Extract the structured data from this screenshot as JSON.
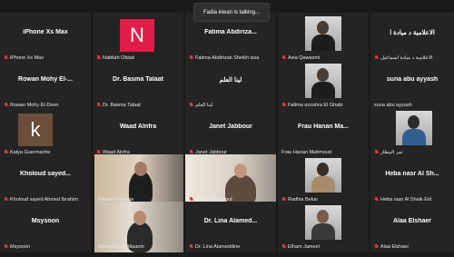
{
  "toast": {
    "text": "Fadia kiwan is talking..."
  },
  "tiles": [
    {
      "big": "iPhone Xs Max",
      "small": "iPhone Xs Max"
    },
    {
      "big": "",
      "small": "Nabilah Obiad",
      "avatar": "N",
      "avatar_color": "#e11d48"
    },
    {
      "big": "Fatima  Abdiriza...",
      "small": "Fatima Abdirizak Sheikh issa"
    },
    {
      "big": "",
      "small": "Asia Qawasmi",
      "photo": true
    },
    {
      "big": "الاعلامية د ميادة ا",
      "small": "الاعلامية د ميادة اسماعيل"
    },
    {
      "big": "Rowan  Mohy  El-...",
      "small": "Rowan Mohy El-Deen"
    },
    {
      "big": "Dr. Basma Talaat",
      "small": "Dr. Basma Talaat"
    },
    {
      "big": "لينا العلم",
      "small": "لينا العلم"
    },
    {
      "big": "",
      "small": "Fatima ezzahra El Ghabi",
      "photo": true
    },
    {
      "big": "suna abu ayyash",
      "small": "suna abu ayyash"
    },
    {
      "big": "",
      "small": "Katya Guermache",
      "avatar": "k",
      "avatar_color": "#6b4f3a"
    },
    {
      "big": "Waad Alnfra",
      "small": "Waad Alnfra"
    },
    {
      "big": "Janet Jabbour",
      "small": "Janet Jabbour"
    },
    {
      "big": "Frau  Hanan  Ma...",
      "small": "Frau Hanan Mahmoud"
    },
    {
      "big": "",
      "small": "تمر البيطار",
      "photo": true
    },
    {
      "big": "Kholoud  sayed...",
      "small": "Kholoud sayed Ahmed Ibrahim"
    },
    {
      "big": "",
      "small": "Fadwa Khawaja",
      "video": true
    },
    {
      "big": "",
      "small": "Zeinab Makhlouf",
      "video": true
    },
    {
      "big": "",
      "small": "Radhia Bekai",
      "photo": true
    },
    {
      "big": "Heba  nasr  Al Sh...",
      "small": "Heba nasr Al Sheik Eid"
    },
    {
      "big": "Msysoon",
      "small": "Msysoon"
    },
    {
      "big": "",
      "small": "Ibtisam O M Altaanin",
      "video": true
    },
    {
      "big": "Dr.  Lina  Alamed...",
      "small": "Dr. Lina Alameddine"
    },
    {
      "big": "",
      "small": "Elham Jameel",
      "photo": true
    },
    {
      "big": "Alaa Elshaer",
      "small": "Alaa Elshaer"
    }
  ]
}
